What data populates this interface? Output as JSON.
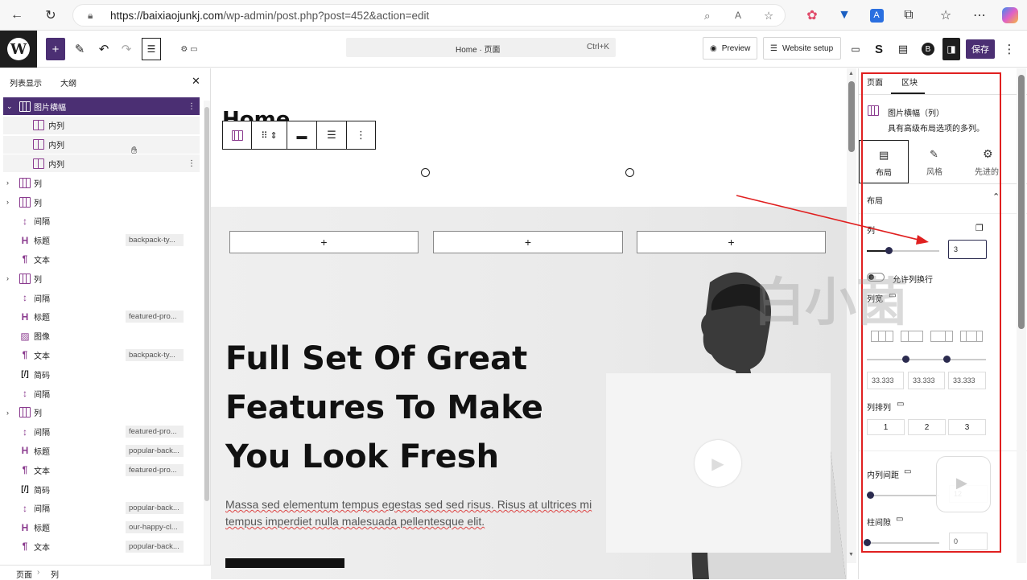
{
  "browser": {
    "url_host": "https://baixiaojunkj.com",
    "url_path": "/wp-admin/post.php?post=452&action=edit",
    "icons": [
      "back-icon",
      "refresh-icon",
      "lock-icon",
      "zoom-icon",
      "read-aloud-icon",
      "favorite-icon",
      "extension-icons",
      "more-icon",
      "copilot-icon"
    ]
  },
  "toolbar": {
    "command_title": "Home · 页面",
    "command_shortcut": "Ctrl+K",
    "preview_label": "Preview",
    "website_setup_label": "Website setup",
    "save_label": "保存",
    "accent": "#4b2f73"
  },
  "left_panel": {
    "tab_list": "列表显示",
    "tab_outline": "大纲",
    "items": [
      {
        "label": "图片横幅",
        "tag": "",
        "icon": "columns-icon",
        "depth": 0,
        "expanded": true,
        "selected": true
      },
      {
        "label": "内列",
        "tag": "",
        "icon": "column-icon",
        "depth": 1
      },
      {
        "label": "内列",
        "tag": "",
        "icon": "column-icon",
        "depth": 1
      },
      {
        "label": "内列",
        "tag": "",
        "icon": "column-icon",
        "depth": 1
      },
      {
        "label": "列",
        "tag": "",
        "icon": "columns-icon",
        "depth": 0,
        "expandable": true
      },
      {
        "label": "列",
        "tag": "",
        "icon": "columns-icon",
        "depth": 0,
        "expandable": true
      },
      {
        "label": "间隔",
        "tag": "",
        "icon": "spacer-icon",
        "depth": 0
      },
      {
        "label": "标题",
        "tag": "backpack-ty...",
        "icon": "heading-icon",
        "depth": 0
      },
      {
        "label": "文本",
        "tag": "",
        "icon": "paragraph-icon",
        "depth": 0
      },
      {
        "label": "列",
        "tag": "",
        "icon": "columns-icon",
        "depth": 0,
        "expandable": true
      },
      {
        "label": "间隔",
        "tag": "",
        "icon": "spacer-icon",
        "depth": 0
      },
      {
        "label": "标题",
        "tag": "featured-pro...",
        "icon": "heading-icon",
        "depth": 0
      },
      {
        "label": "图像",
        "tag": "",
        "icon": "image-icon",
        "depth": 0
      },
      {
        "label": "文本",
        "tag": "backpack-ty...",
        "icon": "paragraph-icon",
        "depth": 0
      },
      {
        "label": "简码",
        "tag": "",
        "icon": "shortcode-icon",
        "depth": 0
      },
      {
        "label": "间隔",
        "tag": "",
        "icon": "spacer-icon",
        "depth": 0
      },
      {
        "label": "列",
        "tag": "",
        "icon": "columns-icon",
        "depth": 0,
        "expandable": true
      },
      {
        "label": "间隔",
        "tag": "featured-pro...",
        "icon": "spacer-icon",
        "depth": 0
      },
      {
        "label": "标题",
        "tag": "popular-back...",
        "icon": "heading-icon",
        "depth": 0
      },
      {
        "label": "文本",
        "tag": "featured-pro...",
        "icon": "paragraph-icon",
        "depth": 0
      },
      {
        "label": "简码",
        "tag": "",
        "icon": "shortcode-icon",
        "depth": 0
      },
      {
        "label": "间隔",
        "tag": "popular-back...",
        "icon": "spacer-icon",
        "depth": 0
      },
      {
        "label": "标题",
        "tag": "our-happy-cl...",
        "icon": "heading-icon",
        "depth": 0
      },
      {
        "label": "文本",
        "tag": "popular-back...",
        "icon": "paragraph-icon",
        "depth": 0
      }
    ],
    "breadcrumb": [
      "页面",
      "列"
    ]
  },
  "canvas": {
    "page_title": "Home",
    "hero_heading_lines": [
      "Full Set Of Great",
      "Features To Make",
      "You Look Fresh"
    ],
    "hero_paragraph_lines": [
      "Massa sed elementum tempus egestas sed sed risus. Risus at ultrices mi",
      "tempus imperdiet nulla malesuada pellentesque elit."
    ],
    "appender_symbol": "+"
  },
  "right_panel": {
    "tab_page": "页面",
    "tab_block": "区块",
    "block_name": "图片横幅（列）",
    "block_desc": "具有高级布局选项的多列。",
    "subtabs": [
      "布局",
      "风格",
      "先进的"
    ],
    "section_layout": "布局",
    "columns_label": "列",
    "columns_value": "3",
    "columns_slider_fraction": 0.3,
    "wrap_toggle_label": "允许列换行",
    "col_width_label": "列宽",
    "col_widths": [
      "33.333",
      "33.333",
      "33.333"
    ],
    "arrange_label": "列排列",
    "arrange_options": [
      "1",
      "2",
      "3"
    ],
    "inner_gap_label": "内列间距",
    "inner_gap_value": "12",
    "col_gap_label": "柱间隙",
    "col_gap_value": "0"
  },
  "watermark": "白小菌"
}
